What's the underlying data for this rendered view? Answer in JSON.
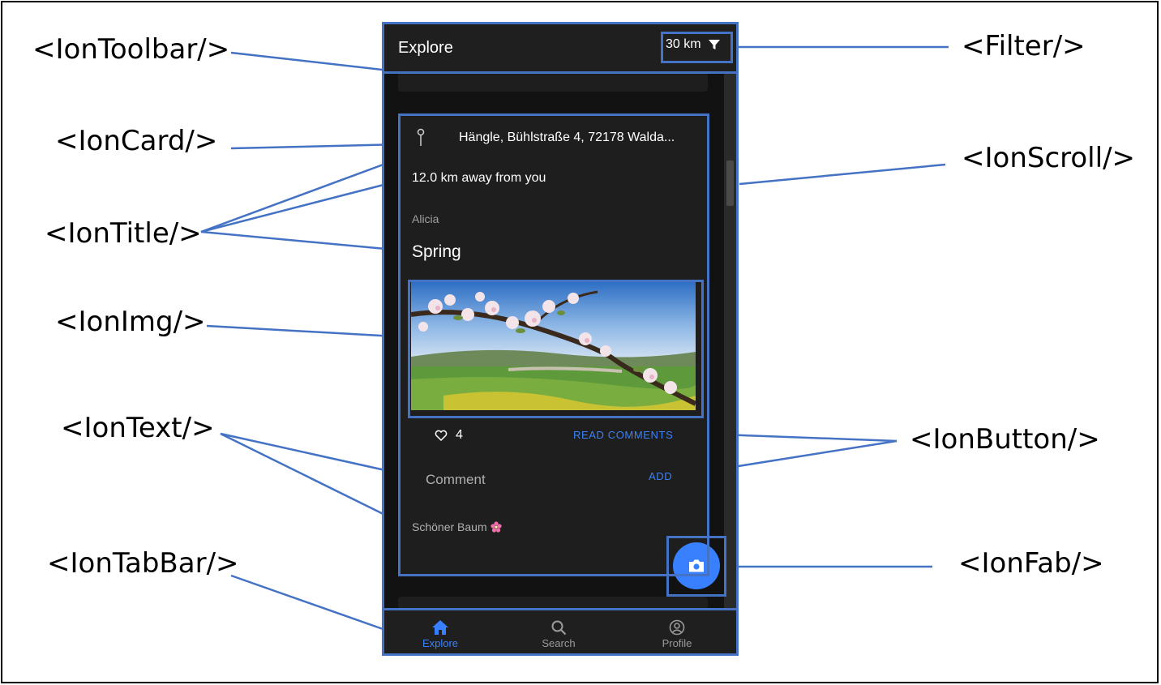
{
  "labels": {
    "toolbar": "<IonToolbar/>",
    "card": "<IonCard/>",
    "title": "<IonTitle/>",
    "img": "<IonImg/>",
    "text": "<IonText/>",
    "tabbar": "<IonTabBar/>",
    "filter": "<Filter/>",
    "scroll": "<IonScroll/>",
    "button": "<IonButton/>",
    "fab": "<IonFab/>"
  },
  "app": {
    "title": "Explore",
    "filter_value": "30 km",
    "post": {
      "address": "Hängle, Bühlstraße 4, 72178 Walda...",
      "distance": "12.0 km away from you",
      "author": "Alicia",
      "title": "Spring",
      "likes": "4",
      "read_comments": "READ COMMENTS",
      "comment_label": "Comment",
      "add": "ADD",
      "comment_text": "Schöner Baum"
    },
    "tabs": [
      {
        "label": "Explore",
        "icon": "home-icon",
        "active": true
      },
      {
        "label": "Search",
        "icon": "search-icon",
        "active": false
      },
      {
        "label": "Profile",
        "icon": "person-circle-icon",
        "active": false
      }
    ]
  },
  "colors": {
    "annotation": "#4472c4",
    "accent": "#3880ff",
    "background": "#121212",
    "surface": "#1e1e1e"
  }
}
